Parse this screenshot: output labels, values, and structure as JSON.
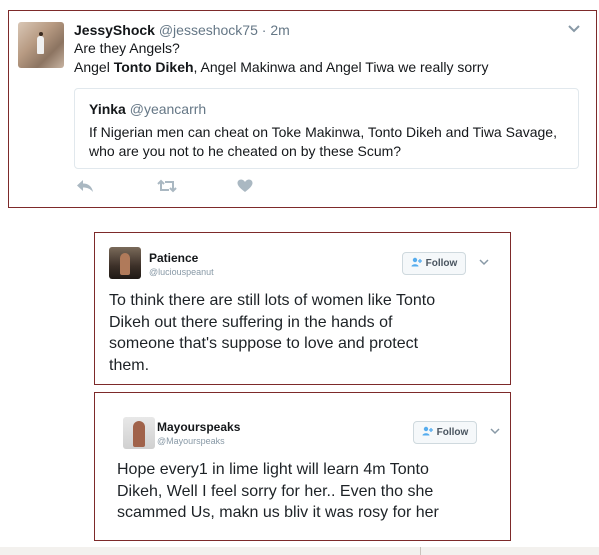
{
  "tweet1": {
    "name": "JessyShock",
    "handle": "@jesseshock75",
    "separator": "·",
    "time": "2m",
    "line1": "Are they Angels?",
    "line2_pre": "Angel ",
    "line2_bold": "Tonto Dikeh",
    "line2_post": ", Angel Makinwa and Angel Tiwa we really sorry",
    "quote": {
      "name": "Yinka",
      "handle": "@yeancarrh",
      "line1": "If Nigerian men can cheat on Toke Makinwa, Tonto Dikeh and Tiwa Savage,",
      "line2": "who are you not to he cheated on by these Scum?"
    },
    "icons": {
      "menu": "chevron-down-icon",
      "reply": "reply-icon",
      "retweet": "retweet-icon",
      "like": "heart-icon"
    }
  },
  "tweet2": {
    "name": "Patience",
    "handle": "@luciouspeanut",
    "follow_label": "Follow",
    "lines": [
      "To think there are still lots of women like Tonto",
      "Dikeh out there suffering in the hands of",
      "someone that's suppose to love and protect",
      "them."
    ]
  },
  "tweet3": {
    "name": "Mayourspeaks",
    "handle": "@Mayourspeaks",
    "follow_label": "Follow",
    "lines": [
      "Hope every1 in lime light will learn 4m Tonto",
      "Dikeh, Well I feel sorry for her.. Even tho she",
      "scammed Us, makn us bliv it was rosy for her"
    ]
  },
  "colors": {
    "card_border": "#7d2a2a",
    "handle_gray": "#657786",
    "action_gray": "#aab8c2",
    "follow_icon_blue": "#55acee"
  }
}
